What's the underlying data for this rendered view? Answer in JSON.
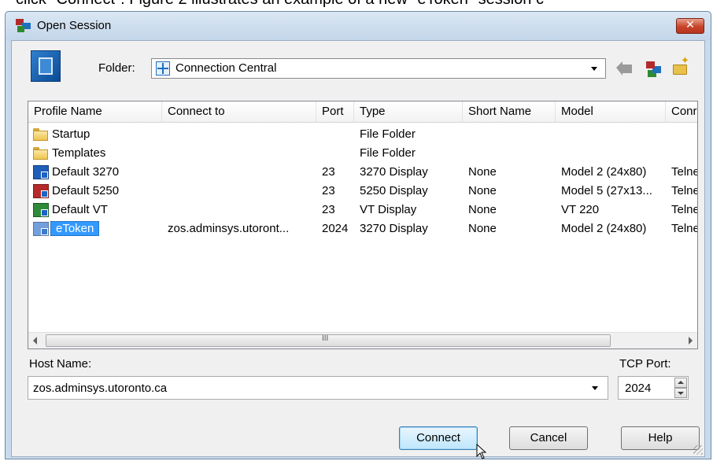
{
  "doc": {
    "caption_fragment": "click \"Connect\". Figure 2 illustrates an example of a new \"eToken\" session c"
  },
  "window": {
    "title": "Open Session",
    "close_symbol": "✕"
  },
  "folder": {
    "label": "Folder:",
    "value": "Connection Central"
  },
  "toolbar": {
    "icons": [
      "back-icon",
      "network-icon",
      "new-folder-icon"
    ]
  },
  "list": {
    "columns": [
      "Profile Name",
      "Connect to",
      "Port",
      "Type",
      "Short Name",
      "Model",
      "Conr"
    ],
    "rows": [
      {
        "name": "Startup",
        "connect": "",
        "port": "",
        "type": "File Folder",
        "short": "",
        "model": "",
        "conn": "",
        "icon": "folder-icon"
      },
      {
        "name": "Templates",
        "connect": "",
        "port": "",
        "type": "File Folder",
        "short": "",
        "model": "",
        "conn": "",
        "icon": "folder-icon"
      },
      {
        "name": "Default 3270",
        "connect": "",
        "port": "23",
        "type": "3270 Display",
        "short": "None",
        "model": "Model 2 (24x80)",
        "conn": "Telne",
        "icon": "terminal-3270-icon"
      },
      {
        "name": "Default 5250",
        "connect": "",
        "port": "23",
        "type": "5250 Display",
        "short": "None",
        "model": "Model 5 (27x13...",
        "conn": "Telne",
        "icon": "terminal-5250-icon"
      },
      {
        "name": "Default VT",
        "connect": "",
        "port": "23",
        "type": "VT Display",
        "short": "None",
        "model": "VT 220",
        "conn": "Telne",
        "icon": "terminal-vt-icon"
      },
      {
        "name": "eToken",
        "connect": "zos.adminsys.utoront...",
        "port": "2024",
        "type": "3270 Display",
        "short": "None",
        "model": "Model 2 (24x80)",
        "conn": "Telne",
        "icon": "terminal-3270-icon",
        "selected": true
      }
    ],
    "scroll_grip": "III"
  },
  "host": {
    "label": "Host Name:",
    "value": "zos.adminsys.utoronto.ca"
  },
  "port": {
    "label": "TCP Port:",
    "value": "2024"
  },
  "buttons": {
    "connect": "Connect",
    "cancel": "Cancel",
    "help": "Help"
  },
  "colors": {
    "selection": "#3399ff",
    "dialog_frame": "#c8daec",
    "icon_3270": "#1f5fb8",
    "icon_5250": "#b52a2a",
    "icon_vt": "#2e8b3a"
  }
}
